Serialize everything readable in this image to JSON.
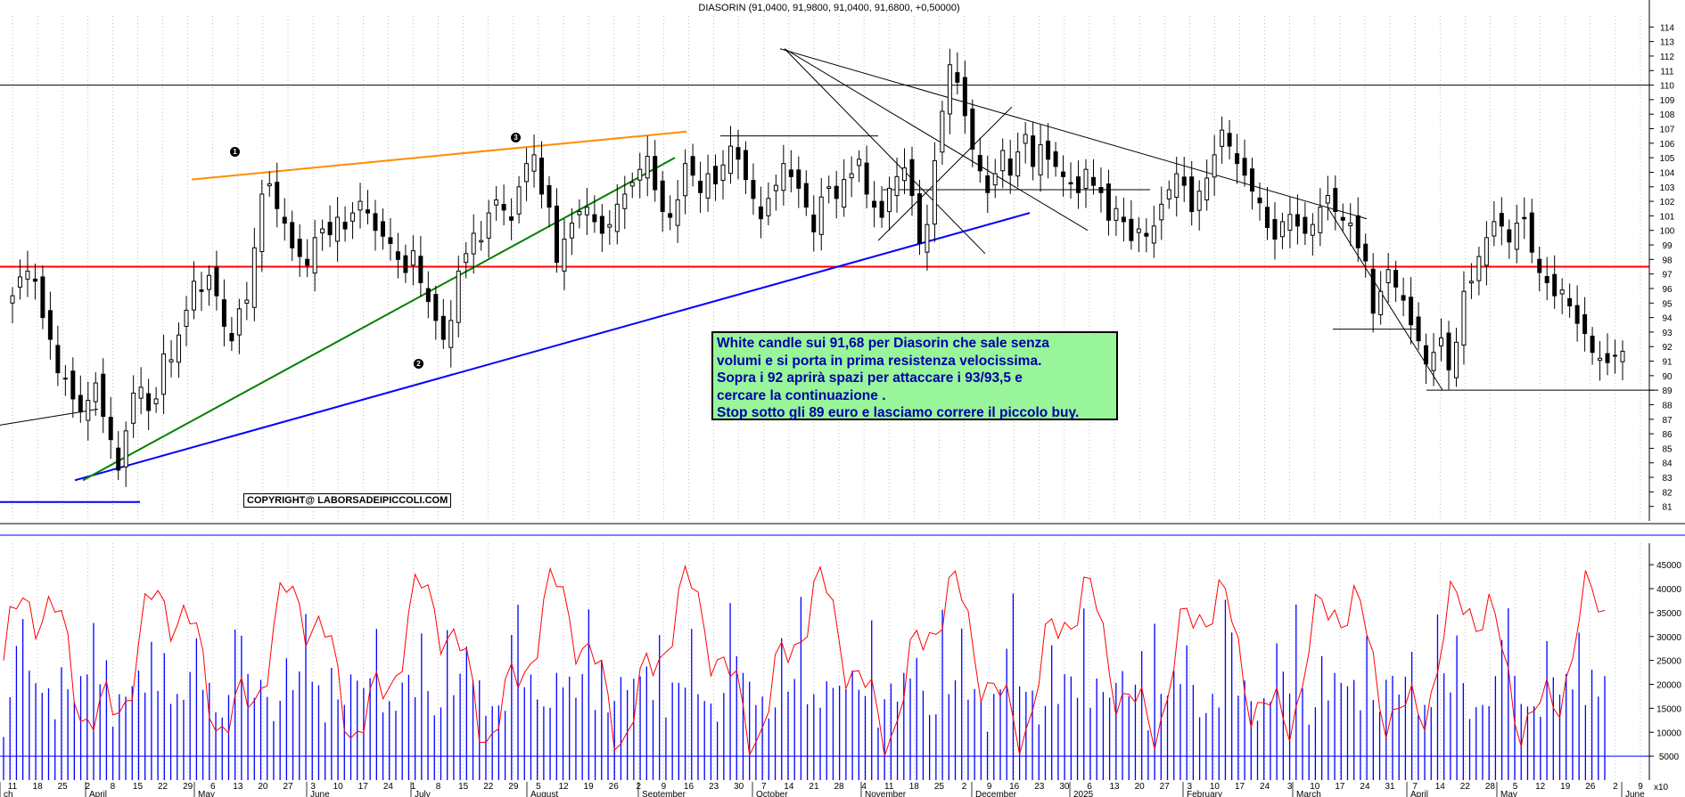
{
  "chart_data": {
    "type": "candlestick",
    "title": "DIASORIN (91,0400, 91,9800, 91,0400, 91,6800, +0,50000)",
    "price_axis": {
      "ylim": [
        80,
        115
      ],
      "ticks": [
        81,
        82,
        83,
        84,
        85,
        86,
        87,
        88,
        89,
        90,
        91,
        92,
        93,
        94,
        95,
        96,
        97,
        98,
        99,
        100,
        101,
        102,
        103,
        104,
        105,
        106,
        107,
        108,
        109,
        110,
        111,
        112,
        113,
        114
      ]
    },
    "volume_axis": {
      "ylim": [
        0,
        48000
      ],
      "ticks": [
        5000,
        10000,
        15000,
        20000,
        25000,
        30000,
        35000,
        40000,
        45000
      ]
    },
    "x_axis": {
      "day_ticks": [
        "11",
        "18",
        "25",
        "2",
        "8",
        "15",
        "22",
        "29",
        "6",
        "13",
        "20",
        "27",
        "3",
        "10",
        "17",
        "24",
        "1",
        "8",
        "15",
        "22",
        "29",
        "5",
        "12",
        "19",
        "26",
        "2",
        "9",
        "16",
        "23",
        "30",
        "7",
        "14",
        "21",
        "28",
        "4",
        "11",
        "18",
        "25",
        "2",
        "9",
        "16",
        "23",
        "30",
        "6",
        "13",
        "20",
        "27",
        "3",
        "10",
        "17",
        "24",
        "3",
        "10",
        "17",
        "24",
        "31",
        "7",
        "14",
        "22",
        "28",
        "5",
        "12",
        "19",
        "26",
        "2",
        "9"
      ],
      "month_labels": [
        "ch",
        "April",
        "May",
        "June",
        "July",
        "August",
        "September",
        "October",
        "November",
        "December",
        "2025",
        "February",
        "March",
        "April",
        "May",
        "June"
      ]
    },
    "levels": {
      "resistance": 97.5,
      "top_line": 110,
      "support_box_high": 93.2,
      "support_box_low": 89,
      "early_support": 81.3,
      "mid_box": 102.8,
      "top_box": 106.5
    },
    "trendlines": [
      {
        "name": "blue-uptrend",
        "color": "#0000ff",
        "points": [
          [
            84,
            82.8
          ],
          [
            1155,
            101.2
          ]
        ]
      },
      {
        "name": "green-uptrend",
        "color": "#008000",
        "points": [
          [
            93,
            82.8
          ],
          [
            757,
            105
          ]
        ]
      },
      {
        "name": "orange-resistance",
        "color": "#ff8c00",
        "points": [
          [
            215,
            103.5
          ],
          [
            770,
            106.8
          ]
        ]
      },
      {
        "name": "downtrend-long",
        "color": "#000000",
        "points": [
          [
            875,
            112.5
          ],
          [
            1533,
            100.8
          ]
        ]
      },
      {
        "name": "downtrend-steep",
        "color": "#000000",
        "points": [
          [
            880,
            112.5
          ],
          [
            1105,
            98.4
          ]
        ]
      },
      {
        "name": "downtrend-mid",
        "color": "#000000",
        "points": [
          [
            880,
            112.5
          ],
          [
            1220,
            100
          ]
        ]
      },
      {
        "name": "downtrend-recent",
        "color": "#000000",
        "points": [
          [
            1490,
            101.5
          ],
          [
            1618,
            89
          ]
        ]
      }
    ],
    "close_series": [
      95.5,
      96.8,
      97.2,
      96.5,
      94,
      92.5,
      90.2,
      89.8,
      88.4,
      87.5,
      88.3,
      89.5,
      87.2,
      85.6,
      83.5,
      86.2,
      88.8,
      89.2,
      87.6,
      88.4,
      91.5,
      91.1,
      92.8,
      94.5,
      96.5,
      95.8,
      96.9,
      95.5,
      93.4,
      92.4,
      94.6,
      95.2,
      98.8,
      102.5,
      103.2,
      101.5,
      100.5,
      98.8,
      98.2,
      97.6,
      99.5,
      100.1,
      99.7,
      100.9,
      100.1,
      101.2,
      102,
      101.2,
      100,
      99.6,
      99.1,
      98,
      97.1,
      98.6,
      96.4,
      95.1,
      93.8,
      92.5,
      93.8,
      97.2,
      98.4,
      99.8,
      99.3,
      101.2,
      102.1,
      101.4,
      100.7,
      103,
      104.6,
      105.2,
      102.5,
      101.6,
      97.8,
      99.4,
      100.5,
      101.3,
      101.6,
      100.6,
      99.8,
      100.4,
      101.8,
      102.5,
      103.3,
      104.2,
      105.1,
      102.8,
      101.3,
      100.9,
      102.1,
      104.6,
      103.8,
      102.6,
      103.9,
      103.2,
      104.5,
      105.8,
      104.9,
      103.5,
      102.2,
      100.8,
      102.2,
      103.1,
      104.6,
      103.7,
      102.9,
      101.6,
      99.9,
      102.3,
      103,
      102.2,
      103.5,
      103.9,
      104.9,
      102.5,
      101.6,
      100.9,
      102.9,
      103.7,
      104.3,
      102.4,
      99.1,
      100.4,
      104.8,
      108.2,
      111.4,
      110.2,
      107.9,
      105.6,
      104.1,
      102.6,
      103.9,
      105.5,
      103.8,
      105.4,
      106.6,
      104.4,
      105.9,
      104.9,
      104.4,
      103.7,
      103.2,
      102.6,
      104.2,
      103.1,
      102.6,
      100.7,
      101.5,
      100.6,
      99.3,
      100.1,
      99.6,
      100.3,
      101.8,
      102.8,
      103.9,
      103.1,
      101.3,
      102.7,
      103.6,
      105.2,
      106.9,
      105.8,
      104.6,
      103.8,
      102.7,
      101.9,
      100.2,
      99.4,
      100.6,
      101.1,
      100.3,
      99.8,
      100.4,
      101.6,
      102.4,
      101.3,
      100.7,
      100.5,
      98.8,
      97.9,
      94.3,
      95.8,
      97.3,
      96.1,
      95.2,
      93.5,
      92.4,
      90.8,
      91.6,
      92.6,
      90.4,
      92.3,
      95.8,
      96.5,
      98.2,
      99.5,
      100.6,
      100.3,
      99.2,
      100.5,
      100.8,
      98.5,
      97.1,
      96.4,
      95.5,
      95.9,
      94.8,
      93.6,
      92.9,
      91.6,
      91.2,
      90.9,
      91.4,
      91.68
    ],
    "volume_bars_note": "blue bars",
    "oscillator_note": "red line"
  },
  "annotations": {
    "note_lines": [
      "White candle sui 91,68 per Diasorin che sale senza",
      "volumi e si porta in prima resistenza velocissima.",
      "Sopra i 92 aprirà spazi per attaccare i 93/93,5 e",
      "cercare la continuazione .",
      "Stop sotto gli 89 euro e lasciamo correre il piccolo buy."
    ],
    "copyright": "COPYRIGHT@ LABORSADEIPICCOLI.COM",
    "pivots": [
      "1",
      "2",
      "3"
    ],
    "volume_tag": "x10"
  },
  "colors": {
    "candle": "#000000",
    "resistance": "#ff0000",
    "volume": "#0000ff",
    "oscillator": "#ff0000",
    "note_bg": "#99f599",
    "note_text": "#0000a8",
    "grid": "#9a9a9a"
  }
}
